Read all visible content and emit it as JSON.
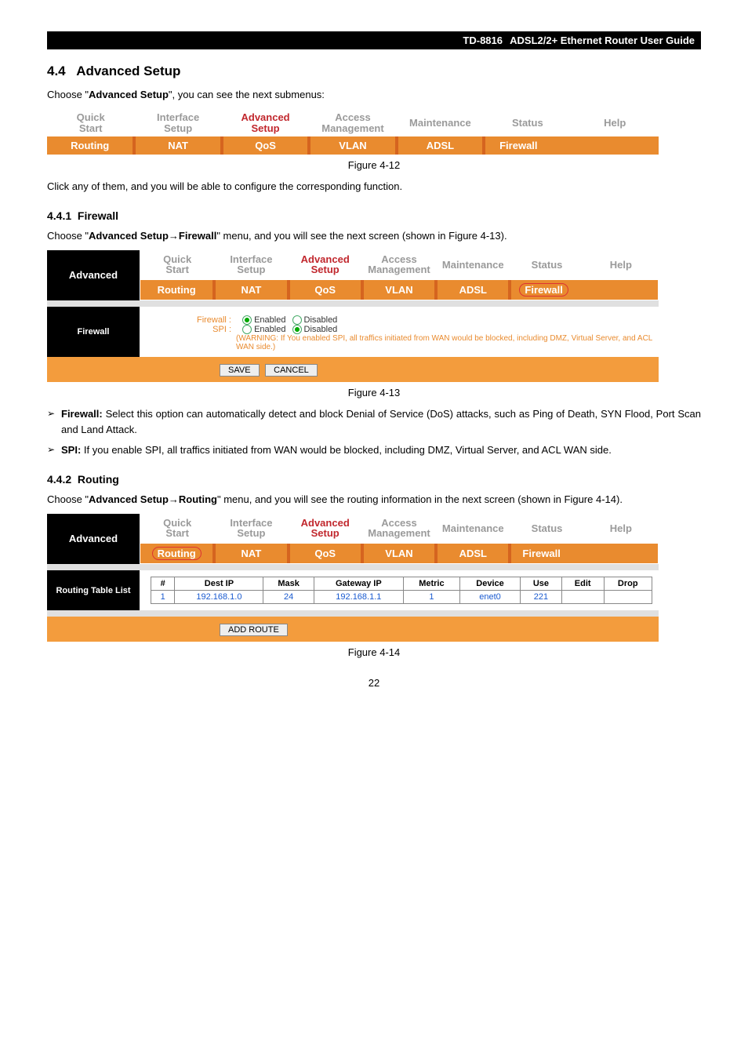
{
  "header": {
    "model": "TD-8816",
    "title": "ADSL2/2+  Ethernet  Router  User  Guide"
  },
  "section": {
    "num": "4.4",
    "title": "Advanced Setup"
  },
  "intro1a": "Choose \"",
  "intro1b": "Advanced Setup",
  "intro1c": "\", you can see the next submenus:",
  "nav1": {
    "tabs": [
      "Quick Start",
      "Interface Setup",
      "Advanced Setup",
      "Access Management",
      "Maintenance",
      "Status",
      "Help"
    ],
    "subs": [
      "Routing",
      "NAT",
      "QoS",
      "VLAN",
      "ADSL",
      "Firewall"
    ]
  },
  "fig12": "Figure 4-12",
  "intro2": "Click any of them, and you will be able to configure the corresponding function.",
  "sub441": {
    "num": "4.4.1",
    "title": "Firewall"
  },
  "p441a": "Choose \"",
  "p441b": "Advanced Setup→Firewall",
  "p441c": "\" menu, and you will see the next screen (shown in Figure 4-13).",
  "shot1": {
    "sideTop": "Advanced",
    "sideMid": "Firewall",
    "tabs": [
      "Quick Start",
      "Interface Setup",
      "Advanced Setup",
      "Access Management",
      "Maintenance",
      "Status",
      "Help"
    ],
    "subs": [
      "Routing",
      "NAT",
      "QoS",
      "VLAN",
      "ADSL",
      "Firewall"
    ],
    "form": {
      "firewallLbl": "Firewall :",
      "spiLbl": "SPI :",
      "enabled": "Enabled",
      "disabled": "Disabled",
      "warn": "(WARNING: If You enabled SPI, all traffics initiated from WAN would be blocked, including DMZ, Virtual Server, and ACL WAN side.)",
      "save": "SAVE",
      "cancel": "CANCEL"
    }
  },
  "fig13": "Figure 4-13",
  "bullets": [
    {
      "term": "Firewall:",
      "text": " Select this option can automatically detect and block Denial of Service (DoS) attacks, such as Ping of Death, SYN Flood, Port Scan and Land Attack."
    },
    {
      "term": "SPI:",
      "text": " If you enable SPI, all traffics initiated from WAN would be blocked, including DMZ, Virtual Server, and ACL WAN side."
    }
  ],
  "sub442": {
    "num": "4.4.2",
    "title": "Routing"
  },
  "p442a": "Choose \"",
  "p442b": "Advanced Setup→Routing",
  "p442c": "\" menu, and you will see the routing information in the next screen (shown in Figure 4-14).",
  "shot2": {
    "sideTop": "Advanced",
    "sideMid": "Routing Table List",
    "tabs": [
      "Quick Start",
      "Interface Setup",
      "Advanced Setup",
      "Access Management",
      "Maintenance",
      "Status",
      "Help"
    ],
    "subs": [
      "Routing",
      "NAT",
      "QoS",
      "VLAN",
      "ADSL",
      "Firewall"
    ],
    "tableHead": [
      "#",
      "Dest IP",
      "Mask",
      "Gateway IP",
      "Metric",
      "Device",
      "Use",
      "Edit",
      "Drop"
    ],
    "tableRow": [
      "1",
      "192.168.1.0",
      "24",
      "192.168.1.1",
      "1",
      "enet0",
      "221",
      "",
      ""
    ],
    "addRoute": "ADD ROUTE"
  },
  "fig14": "Figure 4-14",
  "pageNum": "22"
}
